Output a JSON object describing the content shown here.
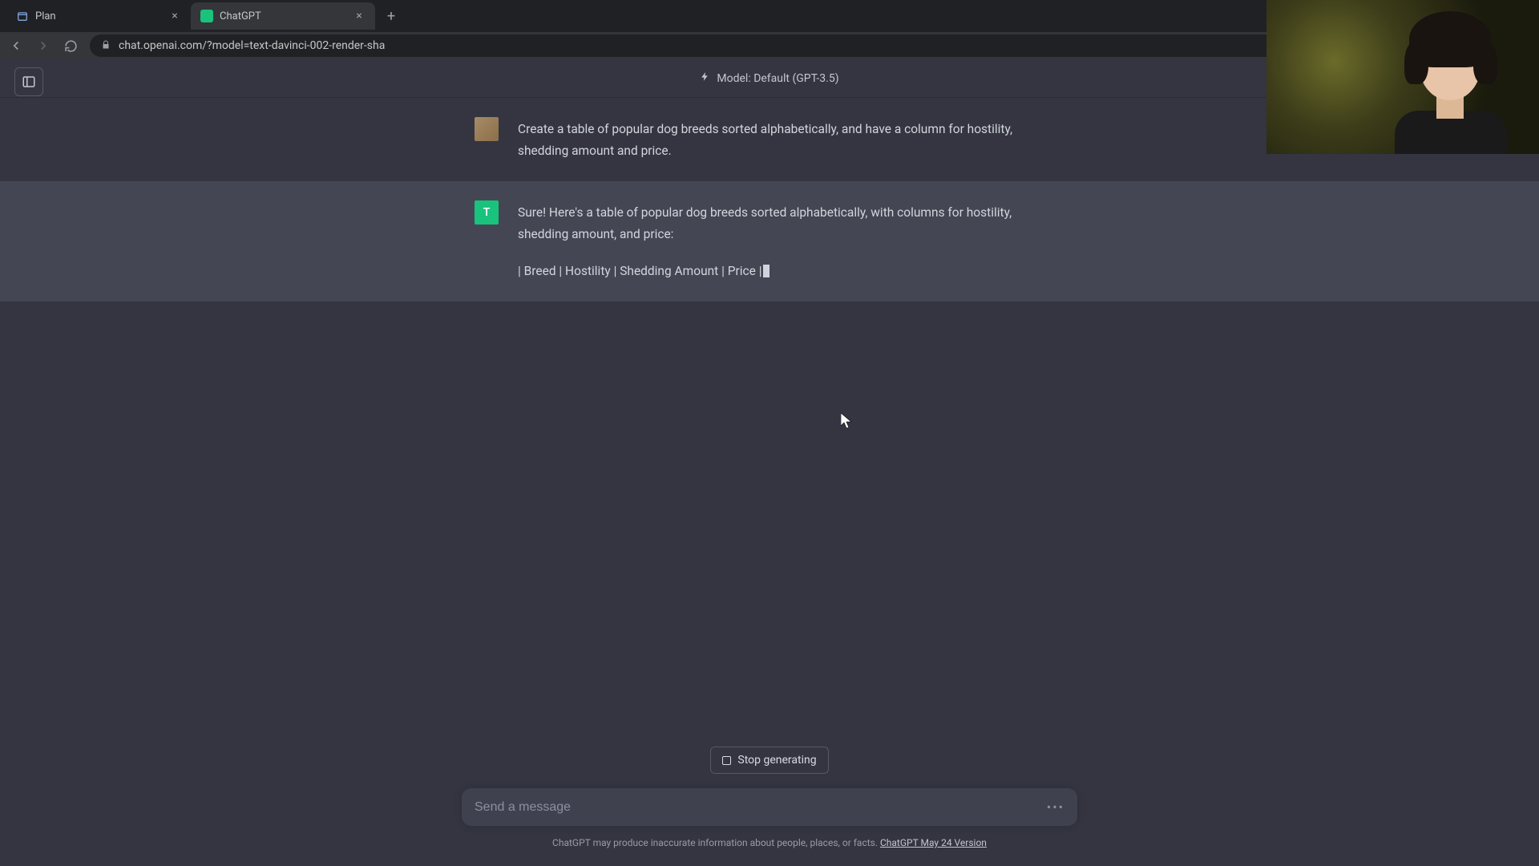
{
  "browser": {
    "tabs": [
      {
        "title": "Plan",
        "favicon": "plan",
        "active": false
      },
      {
        "title": "ChatGPT",
        "favicon": "chatgpt",
        "active": true
      }
    ],
    "url": "chat.openai.com/?model=text-davinci-002-render-sha"
  },
  "app": {
    "model_label": "Model: Default (GPT-3.5)"
  },
  "conversation": {
    "user_avatar_letter": "",
    "bot_avatar_letter": "T",
    "user_message": "Create a table of popular dog breeds sorted alphabetically, and have a column for hostility, shedding amount and price.",
    "assistant_intro": "Sure! Here's a table of popular dog breeds sorted alphabetically, with columns for hostility, shedding amount, and price:",
    "assistant_table_header": "| Breed | Hostility | Shedding Amount | Price |"
  },
  "controls": {
    "stop_label": "Stop generating",
    "input_placeholder": "Send a message",
    "footnote_text": "ChatGPT may produce inaccurate information about people, places, or facts. ",
    "footnote_link": "ChatGPT May 24 Version"
  }
}
